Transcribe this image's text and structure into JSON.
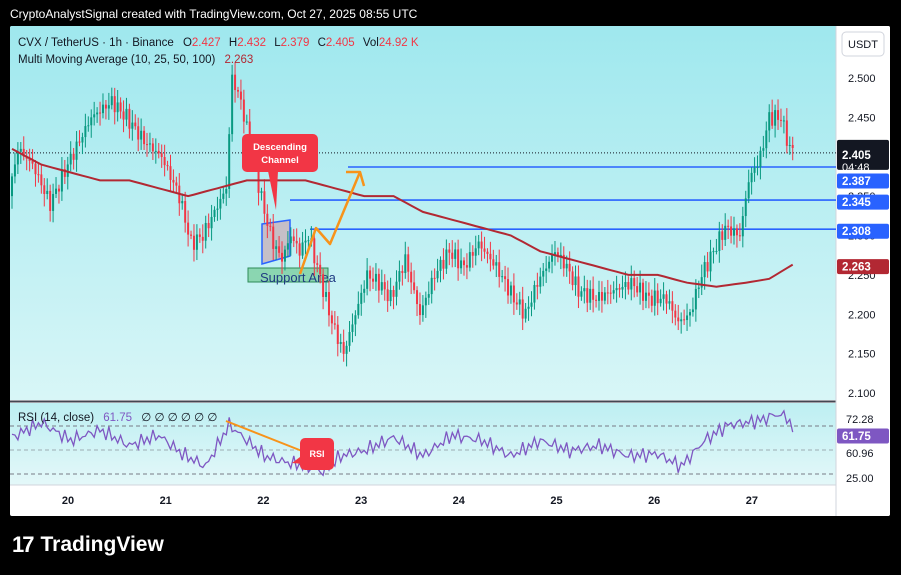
{
  "header": {
    "text": "CryptoAnalystSignal created with TradingView.com, Oct 27, 2025 08:55 UTC"
  },
  "footer": {
    "brand": "TradingView"
  },
  "colors": {
    "bull": "#089981",
    "bear": "#f23645",
    "ma": "#b22833",
    "level": "#2962ff",
    "rsi": "#7e57c2",
    "arrow": "#f7931a",
    "bg_top": "#9fe8ee",
    "bg_bottom": "#d8f6f7"
  },
  "legend": {
    "symbol": "CVX / TetherUS · 1h · Binance",
    "o_label": "O",
    "o_val": "2.427",
    "h_label": "H",
    "h_val": "2.432",
    "l_label": "L",
    "l_val": "2.379",
    "c_label": "C",
    "c_val": "2.405",
    "vol_label": "Vol",
    "vol_val": "24.92 K",
    "ma_label": "Multi Moving Average (10, 25, 50, 100)",
    "ma_val": "2.263"
  },
  "rsi_legend": {
    "label": "RSI (14, close)",
    "val": "61.75",
    "extras": "∅ ∅ ∅ ∅ ∅ ∅"
  },
  "currency_button": "USDT",
  "annotations": {
    "descending_channel": "Descending Channel",
    "support": "Support Area",
    "rsi_callout": "RSI"
  },
  "price_tags": {
    "current": "2.405",
    "countdown": "04:48",
    "l1": "2.387",
    "l2": "2.345",
    "l3": "2.308",
    "ma": "2.263"
  },
  "rsi_tags": {
    "top": "72.28",
    "current": "61.75",
    "mid": "60.96",
    "low": "25.00"
  },
  "chart_data": {
    "type": "candlestick",
    "y_axis_ticks": [
      "2.500",
      "2.450",
      "2.400",
      "2.350",
      "2.300",
      "2.250",
      "2.200",
      "2.150",
      "2.100"
    ],
    "ylim": [
      2.1,
      2.5
    ],
    "x_tick_labels": [
      "20",
      "21",
      "22",
      "23",
      "24",
      "25",
      "26",
      "27"
    ],
    "levels": [
      2.387,
      2.345,
      2.308
    ],
    "ma_last": 2.263,
    "current_price": 2.405,
    "rsi": {
      "current": 61.75,
      "levels": [
        72.28,
        60.96,
        25.0
      ]
    },
    "anchors": [
      [
        0,
        2.35
      ],
      [
        3,
        2.41
      ],
      [
        8,
        2.39
      ],
      [
        14,
        2.34
      ],
      [
        20,
        2.39
      ],
      [
        28,
        2.45
      ],
      [
        35,
        2.47
      ],
      [
        40,
        2.45
      ],
      [
        46,
        2.42
      ],
      [
        52,
        2.4
      ],
      [
        58,
        2.35
      ],
      [
        62,
        2.29
      ],
      [
        66,
        2.3
      ],
      [
        70,
        2.33
      ],
      [
        74,
        2.36
      ],
      [
        76,
        2.5
      ],
      [
        79,
        2.47
      ],
      [
        83,
        2.4
      ],
      [
        87,
        2.33
      ],
      [
        90,
        2.29
      ],
      [
        93,
        2.27
      ],
      [
        96,
        2.3
      ],
      [
        99,
        2.28
      ],
      [
        102,
        2.3
      ],
      [
        105,
        2.26
      ],
      [
        110,
        2.19
      ],
      [
        114,
        2.15
      ],
      [
        118,
        2.2
      ],
      [
        122,
        2.25
      ],
      [
        126,
        2.24
      ],
      [
        130,
        2.22
      ],
      [
        135,
        2.27
      ],
      [
        140,
        2.2
      ],
      [
        145,
        2.25
      ],
      [
        150,
        2.28
      ],
      [
        155,
        2.26
      ],
      [
        160,
        2.29
      ],
      [
        166,
        2.26
      ],
      [
        172,
        2.22
      ],
      [
        176,
        2.2
      ],
      [
        180,
        2.24
      ],
      [
        186,
        2.28
      ],
      [
        190,
        2.26
      ],
      [
        194,
        2.23
      ],
      [
        200,
        2.22
      ],
      [
        206,
        2.23
      ],
      [
        212,
        2.24
      ],
      [
        218,
        2.22
      ],
      [
        224,
        2.22
      ],
      [
        228,
        2.19
      ],
      [
        232,
        2.2
      ],
      [
        236,
        2.25
      ],
      [
        240,
        2.28
      ],
      [
        244,
        2.31
      ],
      [
        249,
        2.3
      ],
      [
        252,
        2.37
      ],
      [
        256,
        2.4
      ],
      [
        259,
        2.45
      ],
      [
        263,
        2.45
      ],
      [
        266,
        2.41
      ]
    ],
    "ma_anchors": [
      [
        0,
        2.41
      ],
      [
        10,
        2.39
      ],
      [
        20,
        2.38
      ],
      [
        30,
        2.37
      ],
      [
        40,
        2.37
      ],
      [
        50,
        2.36
      ],
      [
        60,
        2.35
      ],
      [
        70,
        2.36
      ],
      [
        80,
        2.37
      ],
      [
        90,
        2.37
      ],
      [
        100,
        2.37
      ],
      [
        110,
        2.36
      ],
      [
        120,
        2.35
      ],
      [
        130,
        2.35
      ],
      [
        140,
        2.33
      ],
      [
        150,
        2.32
      ],
      [
        160,
        2.31
      ],
      [
        170,
        2.3
      ],
      [
        180,
        2.28
      ],
      [
        190,
        2.27
      ],
      [
        200,
        2.26
      ],
      [
        210,
        2.25
      ],
      [
        220,
        2.25
      ],
      [
        230,
        2.24
      ],
      [
        240,
        2.235
      ],
      [
        250,
        2.24
      ],
      [
        258,
        2.245
      ],
      [
        266,
        2.263
      ]
    ],
    "rsi_anchors": [
      [
        0,
        58
      ],
      [
        10,
        72
      ],
      [
        20,
        55
      ],
      [
        30,
        65
      ],
      [
        40,
        50
      ],
      [
        50,
        60
      ],
      [
        58,
        42
      ],
      [
        66,
        30
      ],
      [
        74,
        70
      ],
      [
        80,
        55
      ],
      [
        86,
        40
      ],
      [
        92,
        35
      ],
      [
        100,
        30
      ],
      [
        106,
        25
      ],
      [
        112,
        40
      ],
      [
        120,
        45
      ],
      [
        130,
        58
      ],
      [
        140,
        40
      ],
      [
        150,
        60
      ],
      [
        160,
        55
      ],
      [
        170,
        40
      ],
      [
        180,
        55
      ],
      [
        190,
        45
      ],
      [
        200,
        50
      ],
      [
        210,
        40
      ],
      [
        220,
        42
      ],
      [
        228,
        30
      ],
      [
        236,
        55
      ],
      [
        244,
        70
      ],
      [
        250,
        72
      ],
      [
        256,
        75
      ],
      [
        260,
        80
      ],
      [
        264,
        78
      ],
      [
        266,
        65
      ]
    ]
  }
}
